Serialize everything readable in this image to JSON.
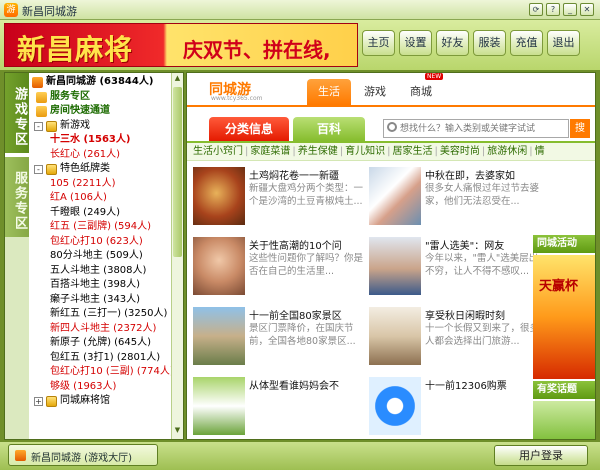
{
  "window": {
    "title": "新昌同城游"
  },
  "header": {
    "banner_title": "新昌麻将",
    "banner_slogan": "庆双节、拼在线,",
    "nav": [
      "主页",
      "设置",
      "好友",
      "服装",
      "充值",
      "退出"
    ]
  },
  "sidebar": {
    "tabs": [
      "游戏专区",
      "服务专区"
    ],
    "tree": [
      {
        "text": "新昌同城游 (63844人)",
        "level": 0,
        "icon": "app",
        "style": "bold"
      },
      {
        "text": "服务专区",
        "level": 1,
        "icon": "house",
        "style": "bold-green"
      },
      {
        "text": "房间快速通道",
        "level": 1,
        "icon": "house",
        "style": "bold-green"
      },
      {
        "text": "新游戏",
        "level": 1,
        "icon": "folder",
        "expand": "-"
      },
      {
        "text": "十三水 (1563人)",
        "level": 2,
        "style": "bold-hot"
      },
      {
        "text": "长红心 (261人)",
        "level": 2,
        "style": "hot"
      },
      {
        "text": "特色纸牌类",
        "level": 1,
        "icon": "folder",
        "expand": "-"
      },
      {
        "text": "105 (2211人)",
        "level": 2,
        "style": "hot"
      },
      {
        "text": "红A (106人)",
        "level": 2,
        "style": "hot"
      },
      {
        "text": "千瞪眼 (249人)",
        "level": 2
      },
      {
        "text": "红五 (三副牌) (594人)",
        "level": 2,
        "style": "hot"
      },
      {
        "text": "包红心打10 (623人)",
        "level": 2,
        "style": "hot"
      },
      {
        "text": "80分斗地主 (509人)",
        "level": 2
      },
      {
        "text": "五人斗地主 (3808人)",
        "level": 2
      },
      {
        "text": "百搭斗地主 (398人)",
        "level": 2
      },
      {
        "text": "癞子斗地主 (343人)",
        "level": 2
      },
      {
        "text": "新红五 (三打一) (3250人)",
        "level": 2
      },
      {
        "text": "新四人斗地主 (2372人)",
        "level": 2,
        "style": "hot"
      },
      {
        "text": "新原子 (允牌) (645人)",
        "level": 2
      },
      {
        "text": "包红五 (3打1) (2801人)",
        "level": 2
      },
      {
        "text": "包红心打10 (三副) (774人)",
        "level": 2,
        "style": "hot"
      },
      {
        "text": "够级 (1963人)",
        "level": 2,
        "style": "hot"
      },
      {
        "text": "同城麻将馆",
        "level": 1,
        "icon": "folder",
        "expand": "+"
      }
    ]
  },
  "content": {
    "logo": "同城游",
    "logo_sub": "www.tcy365.com",
    "tabs": [
      "生活",
      "游戏",
      "商城"
    ],
    "new_badge": "NEW",
    "tab_category": "分类信息",
    "tab_baike": "百科",
    "search_placeholder": "想找什么？输入类别或关键字试试",
    "search_button": "搜",
    "categories": [
      "生活小窍门",
      "家庭菜谱",
      "养生保健",
      "育儿知识",
      "居家生活",
      "美容时尚",
      "旅游休闲",
      "情"
    ],
    "articles": [
      {
        "title": "土鸡焖花卷一一新疆",
        "desc": "新疆大盘鸡分两个类型：一个是沙湾的土豆青椒炖土..."
      },
      {
        "title": "中秋在即，去婆家如",
        "desc": "很多女人痛恨过年过节去婆家，他们无法忍受在..."
      },
      {
        "title": "关于性高潮的10个问",
        "desc": "这些性问题你了解吗？你是否在自己的生活里..."
      },
      {
        "title": "\"雷人选美\"：网友",
        "desc": "今年以来，\"雷人\"选美层出不穷，让人不得不感叹..."
      },
      {
        "title": "十一前全国80家景区",
        "desc": "景区门票降价，在国庆节前，全国各地80家景区..."
      },
      {
        "title": "享受秋日闲暇时刻",
        "desc": "十一个长假又到来了，很多人都会选择出门旅游..."
      },
      {
        "title": "从体型看谁妈妈会不",
        "desc": ""
      },
      {
        "title": "十一前12306购票",
        "desc": ""
      }
    ],
    "side_headers": [
      "同城活动",
      "有奖话题"
    ],
    "side_promo": "天赢杯"
  },
  "footer": {
    "hall_tab": "新昌同城游 (游戏大厅)",
    "login": "用户登录"
  },
  "colors": {
    "accent": "#ff7a00",
    "green": "#86bd2e",
    "hot": "#d40000"
  }
}
